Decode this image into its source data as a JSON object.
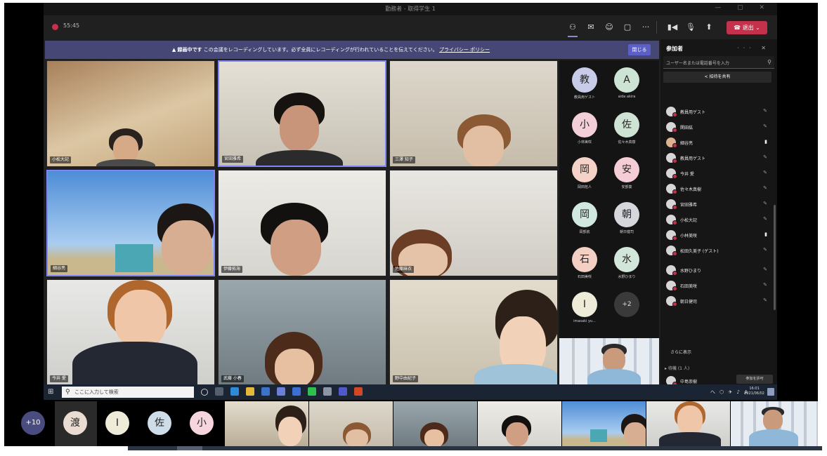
{
  "window": {
    "title": "勤務者 - 取得学生 1"
  },
  "toolbar": {
    "elapsed": "55:45",
    "leave_label": "退出"
  },
  "banner": {
    "prefix": "録画中です",
    "message": "この会議をレコーディングしています。必ず全員にレコーディングが行われていることを伝えてください。",
    "link": "プライバシー ポリシー",
    "dismiss": "閉じる"
  },
  "grid": {
    "tiles": [
      {
        "name": "小松大記"
      },
      {
        "name": "宮田雅希"
      },
      {
        "name": "三澤 知子"
      },
      {
        "name": "細谷亮"
      },
      {
        "name": "伊藤拓海"
      },
      {
        "name": "佐藤麻衣"
      },
      {
        "name": "今井 愛"
      },
      {
        "name": "武藤 小春"
      },
      {
        "name": "野中由紀子"
      }
    ]
  },
  "avatars": [
    {
      "initial": "教",
      "label": "教員用ゲスト",
      "color": "#c9cce8"
    },
    {
      "initial": "A",
      "label": "aida akira",
      "color": "#cde4d5"
    },
    {
      "initial": "小",
      "label": "小林美咲",
      "color": "#f2cfd9"
    },
    {
      "initial": "佐",
      "label": "佐々木真樹",
      "color": "#cfe3d4"
    },
    {
      "initial": "岡",
      "label": "岡田拓人",
      "color": "#f5d2c8"
    },
    {
      "initial": "安",
      "label": "安部葵",
      "color": "#f5cdd6"
    },
    {
      "initial": "岡",
      "label": "岡部航",
      "color": "#d1e8e0"
    },
    {
      "initial": "朝",
      "label": "朝日健司",
      "color": "#d6d7dc"
    },
    {
      "initial": "石",
      "label": "石田美咲",
      "color": "#f4cfc4"
    },
    {
      "initial": "水",
      "label": "水野ひまり",
      "color": "#d2e7d9"
    },
    {
      "initial": "I",
      "label": "imasaki yu...",
      "color": "#eeebd8"
    },
    {
      "initial": "+2",
      "label": "",
      "color": "#3a3a3a"
    }
  ],
  "panel": {
    "title": "参加者",
    "search_placeholder": "ユーザー名または電話番号を入力",
    "share_label": "招待を共有",
    "participants": [
      {
        "name": "教員用ゲスト"
      },
      {
        "name": "関田紘"
      },
      {
        "name": "細谷亮"
      },
      {
        "name": "教員用ゲスト"
      },
      {
        "name": "今井 愛"
      },
      {
        "name": "佐々木真樹"
      },
      {
        "name": "宮田雅希"
      },
      {
        "name": "小松大記"
      },
      {
        "name": "小林美咲"
      },
      {
        "name": "松田久美子 (ゲスト)"
      },
      {
        "name": "水野ひまり"
      },
      {
        "name": "石田美咲"
      },
      {
        "name": "朝日健司"
      }
    ],
    "more_label": "さらに表示",
    "guests_label": "▸ 待機 (1 人)",
    "guest_name": "中島崇樹",
    "admit_label": "参加を許可"
  },
  "taskbar": {
    "search_placeholder": "ここに入力して検索",
    "tray": "へ ⬡ ✈ ♪ A",
    "time": "16:01",
    "date": "2021/06/02"
  },
  "strip": {
    "overflow": "+10",
    "avatars": [
      {
        "initial": "渡",
        "color": "#eadcd2"
      },
      {
        "initial": "I",
        "color": "#eeebd8"
      },
      {
        "initial": "佐",
        "color": "#cfdde9"
      },
      {
        "initial": "小",
        "color": "#f6d6de"
      }
    ]
  },
  "colors": {
    "accent": "#464775",
    "leave": "#c4314b",
    "speaker_border": "#7f85f5"
  }
}
